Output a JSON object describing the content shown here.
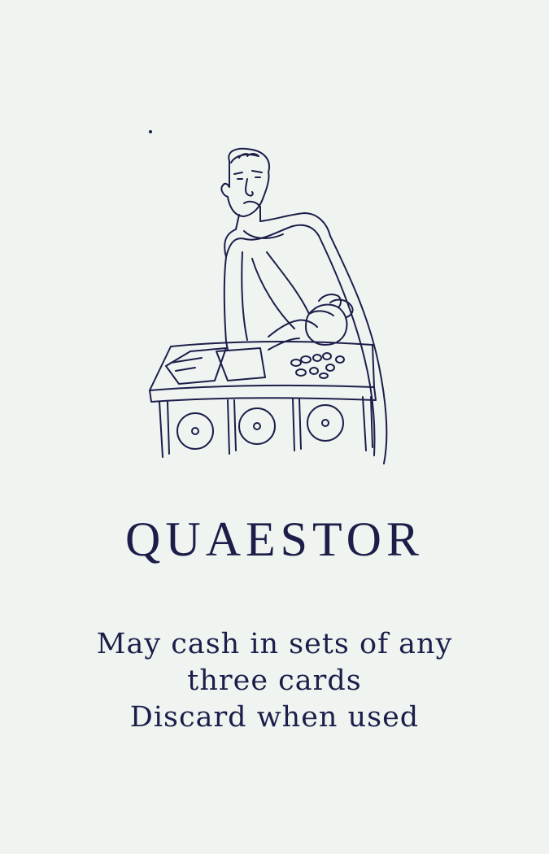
{
  "card": {
    "title": "QUAESTOR",
    "rules": [
      "May cash in sets of any",
      "three cards",
      "Discard when used"
    ],
    "illustration": {
      "subject": "quaestor-counting-coins-icon",
      "ink_color": "#1e1d4a",
      "background_color": "#f0f4f1"
    }
  }
}
